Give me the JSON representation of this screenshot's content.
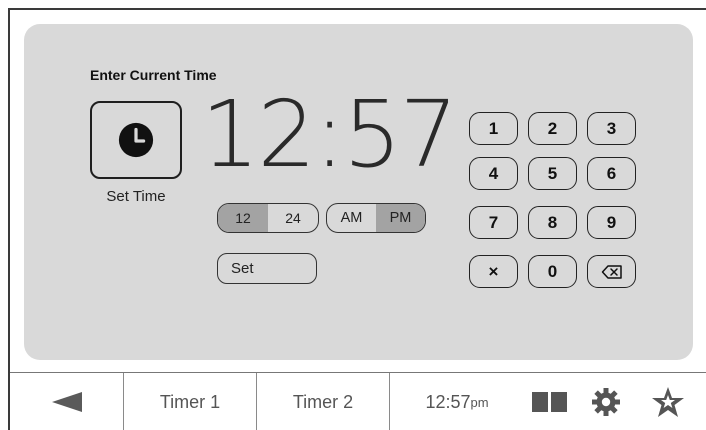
{
  "panel": {
    "title": "Enter Current Time",
    "set_time_label": "Set Time",
    "clock_icon": "clock-icon",
    "time_display": "12:57",
    "format_toggle": [
      {
        "label": "12",
        "selected": true
      },
      {
        "label": "24",
        "selected": false
      }
    ],
    "ampm_toggle": [
      {
        "label": "AM",
        "selected": false
      },
      {
        "label": "PM",
        "selected": true
      }
    ],
    "set_button": "Set",
    "keypad": [
      "1",
      "2",
      "3",
      "4",
      "5",
      "6",
      "7",
      "8",
      "9",
      "×",
      "0",
      "backspace-icon"
    ]
  },
  "bottom_bar": {
    "back_icon": "back-arrow-icon",
    "tab1": "Timer 1",
    "tab2": "Timer 2",
    "time": "12:57",
    "meridiem": "pm",
    "icons": [
      "split-view-icon",
      "gear-icon",
      "star-icon"
    ]
  },
  "colors": {
    "panel_bg": "#d9d9d9",
    "toggle_selected": "#a3a3a3",
    "border": "#222222"
  }
}
